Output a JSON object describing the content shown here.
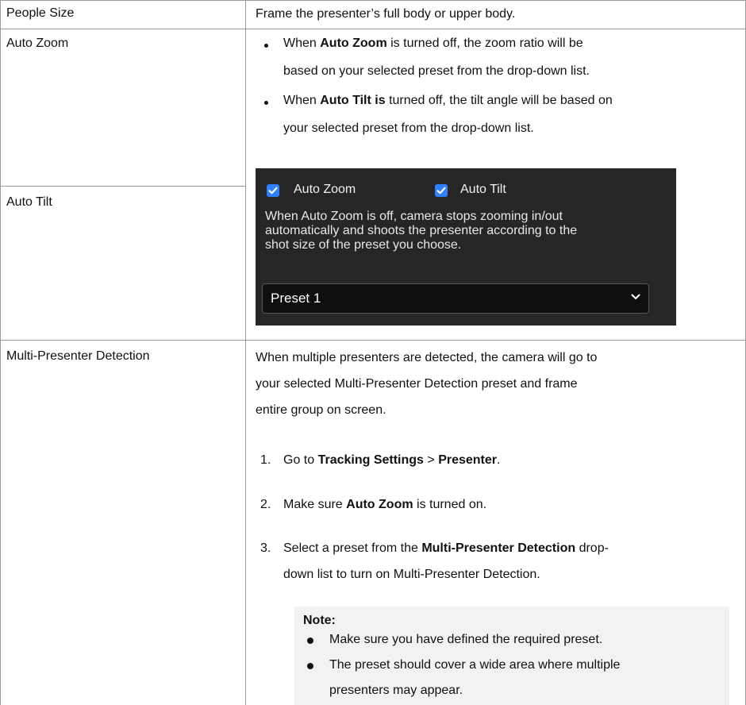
{
  "rows": [
    {
      "label": "People Size",
      "text": "Frame the presenter’s full body or upper body."
    },
    {
      "label": "Auto Zoom",
      "bullets": [
        {
          "pre": "When ",
          "bold": "Auto Zoom",
          "post1": " is turned off, the zoom ratio will be",
          "line2": "based on your selected preset from the drop-down list."
        },
        {
          "pre": "When ",
          "bold": "Auto Tilt is",
          "post1": " turned off, the tilt angle will be based on",
          "line2": "your selected preset from the drop-down list."
        }
      ]
    },
    {
      "label": "Auto Tilt"
    },
    {
      "label": "Multi-Presenter Detection",
      "intro": [
        "When multiple presenters are detected, the camera will go to",
        "your selected Multi-Presenter Detection preset and frame",
        "entire group on screen."
      ],
      "steps": [
        {
          "num": "1.",
          "t1": "Go to ",
          "b1": "Tracking Settings",
          "t2": " > ",
          "b2": "Presenter",
          "t3": "."
        },
        {
          "num": "2.",
          "t1": "Make sure ",
          "b1": "Auto Zoom",
          "t2": " is turned on."
        },
        {
          "num": "3.",
          "t1": "Select a preset from the ",
          "b1": "Multi-Presenter Detection",
          "t2": " drop-",
          "line2": "down list to turn on Multi-Presenter Detection."
        }
      ],
      "note": {
        "title": "Note:",
        "items": [
          {
            "line1": "Make sure you have defined the required preset."
          },
          {
            "line1": "The preset should cover a wide area where multiple",
            "line2": "presenters may appear."
          }
        ]
      }
    }
  ],
  "panel": {
    "auto_zoom": {
      "label": "Auto Zoom",
      "checked": true
    },
    "auto_tilt": {
      "label": "Auto Tilt",
      "checked": true
    },
    "description": [
      "When Auto Zoom is off, camera stops zooming in/out",
      "automatically and shoots the presenter according to the",
      "shot size of the preset you choose."
    ],
    "preset_select": {
      "value": "Preset 1"
    },
    "colors": {
      "background": "#262626",
      "checkbox": "#2f80ff"
    }
  }
}
